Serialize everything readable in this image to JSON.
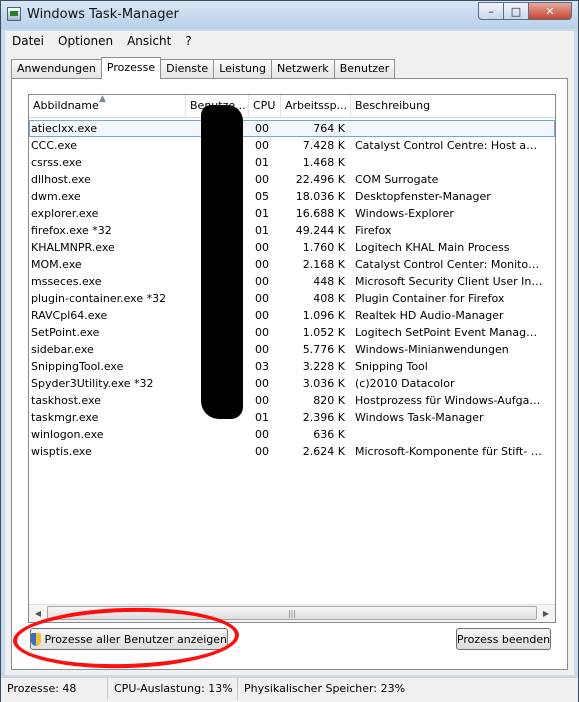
{
  "window": {
    "title": "Windows Task-Manager",
    "buttons": {
      "minimize": "–",
      "maximize": "□",
      "close": "✕"
    }
  },
  "menu": [
    "Datei",
    "Optionen",
    "Ansicht",
    "?"
  ],
  "tabs": [
    "Anwendungen",
    "Prozesse",
    "Dienste",
    "Leistung",
    "Netzwerk",
    "Benutzer"
  ],
  "active_tab": "Prozesse",
  "columns": {
    "name": "Abbildname",
    "user": "Benutze...",
    "cpu": "CPU",
    "mem": "Arbeitssp...",
    "desc": "Beschreibung"
  },
  "processes": [
    {
      "name": "atieclxx.exe",
      "cpu": "00",
      "mem": "764 K",
      "desc": ""
    },
    {
      "name": "CCC.exe",
      "cpu": "00",
      "mem": "7.428 K",
      "desc": "Catalyst Control Centre: Host appli..."
    },
    {
      "name": "csrss.exe",
      "cpu": "01",
      "mem": "1.468 K",
      "desc": ""
    },
    {
      "name": "dllhost.exe",
      "cpu": "00",
      "mem": "22.496 K",
      "desc": "COM Surrogate"
    },
    {
      "name": "dwm.exe",
      "cpu": "05",
      "mem": "18.036 K",
      "desc": "Desktopfenster-Manager"
    },
    {
      "name": "explorer.exe",
      "cpu": "01",
      "mem": "16.688 K",
      "desc": "Windows-Explorer"
    },
    {
      "name": "firefox.exe *32",
      "cpu": "01",
      "mem": "49.244 K",
      "desc": "Firefox"
    },
    {
      "name": "KHALMNPR.exe",
      "cpu": "00",
      "mem": "1.760 K",
      "desc": "Logitech KHAL Main Process"
    },
    {
      "name": "MOM.exe",
      "cpu": "00",
      "mem": "2.168 K",
      "desc": "Catalyst Control Center: Monitorin..."
    },
    {
      "name": "msseces.exe",
      "cpu": "00",
      "mem": "448 K",
      "desc": "Microsoft Security Client User Inter..."
    },
    {
      "name": "plugin-container.exe *32",
      "cpu": "00",
      "mem": "408 K",
      "desc": "Plugin Container for Firefox"
    },
    {
      "name": "RAVCpl64.exe",
      "cpu": "00",
      "mem": "1.096 K",
      "desc": "Realtek HD Audio-Manager"
    },
    {
      "name": "SetPoint.exe",
      "cpu": "00",
      "mem": "1.052 K",
      "desc": "Logitech SetPoint Event Manager (..."
    },
    {
      "name": "sidebar.exe",
      "cpu": "00",
      "mem": "5.776 K",
      "desc": "Windows-Minianwendungen"
    },
    {
      "name": "SnippingTool.exe",
      "cpu": "03",
      "mem": "3.228 K",
      "desc": "Snipping Tool"
    },
    {
      "name": "Spyder3Utility.exe *32",
      "cpu": "00",
      "mem": "3.036 K",
      "desc": "(c)2010 Datacolor"
    },
    {
      "name": "taskhost.exe",
      "cpu": "00",
      "mem": "820 K",
      "desc": "Hostprozess für Windows-Aufgaben"
    },
    {
      "name": "taskmgr.exe",
      "cpu": "01",
      "mem": "2.396 K",
      "desc": "Windows Task-Manager"
    },
    {
      "name": "winlogon.exe",
      "cpu": "00",
      "mem": "636 K",
      "desc": ""
    },
    {
      "name": "wisptis.exe",
      "cpu": "00",
      "mem": "2.624 K",
      "desc": "Microsoft-Komponente für Stift- un..."
    }
  ],
  "buttons": {
    "show_all": "Prozesse aller Benutzer anzeigen",
    "end_process": "Prozess beenden"
  },
  "status": {
    "processes": "Prozesse: 48",
    "cpu": "CPU-Auslastung: 13%",
    "memory": "Physikalischer Speicher: 23%"
  },
  "colors": {
    "annotation": "#ff0e0e",
    "redaction": "#000000"
  }
}
